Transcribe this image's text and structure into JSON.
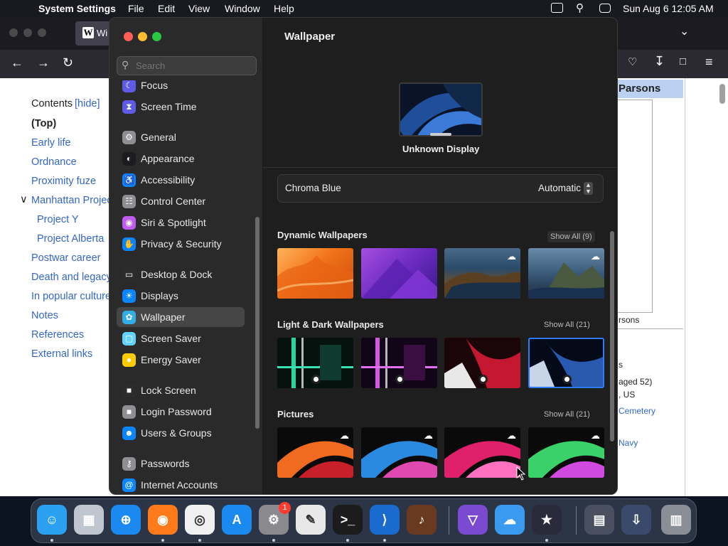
{
  "menubar": {
    "app": "System Settings",
    "menus": [
      "File",
      "Edit",
      "View",
      "Window",
      "Help"
    ],
    "datetime": "Sun Aug 6  12:05 AM"
  },
  "browser": {
    "tab_title": "Wi",
    "toc": {
      "heading": "Contents",
      "hide": "[hide]",
      "items": [
        "(Top)",
        "Early life",
        "Ordnance",
        "Proximity fuze",
        "Manhattan Project",
        "Project Y",
        "Project Alberta",
        "Postwar career",
        "Death and legacy",
        "In popular culture",
        "Notes",
        "References",
        "External links"
      ]
    },
    "article": {
      "infobox_title": "Parsons",
      "caption": "rsons",
      "line1": "s",
      "line2": "aged 52)",
      "line3": ", US",
      "link1": "Cemetery",
      "link2": "Navy"
    }
  },
  "settings": {
    "search_placeholder": "Search",
    "sidebar": [
      {
        "label": "Focus",
        "color": "#5e5ce6",
        "icon": "moon-icon"
      },
      {
        "label": "Screen Time",
        "color": "#5e5ce6",
        "icon": "hourglass-icon"
      },
      {
        "label": "General",
        "color": "#8e8e93",
        "icon": "gear-icon"
      },
      {
        "label": "Appearance",
        "color": "#1c1c1e",
        "icon": "appearance-icon"
      },
      {
        "label": "Accessibility",
        "color": "#0a84ff",
        "icon": "accessibility-icon"
      },
      {
        "label": "Control Center",
        "color": "#8e8e93",
        "icon": "toggles-icon"
      },
      {
        "label": "Siri & Spotlight",
        "color": "#bf5af2",
        "icon": "siri-icon"
      },
      {
        "label": "Privacy & Security",
        "color": "#0a84ff",
        "icon": "hand-icon"
      },
      {
        "label": "Desktop & Dock",
        "color": "#2c2c2e",
        "icon": "dock-icon"
      },
      {
        "label": "Displays",
        "color": "#0a84ff",
        "icon": "sun-icon"
      },
      {
        "label": "Wallpaper",
        "color": "#32ade6",
        "icon": "flower-icon"
      },
      {
        "label": "Screen Saver",
        "color": "#64d2ff",
        "icon": "screensaver-icon"
      },
      {
        "label": "Energy Saver",
        "color": "#ffcc00",
        "icon": "bulb-icon"
      },
      {
        "label": "Lock Screen",
        "color": "#2c2c2e",
        "icon": "lock-icon"
      },
      {
        "label": "Login Password",
        "color": "#8e8e93",
        "icon": "lock-icon"
      },
      {
        "label": "Users & Groups",
        "color": "#0a84ff",
        "icon": "users-icon"
      },
      {
        "label": "Passwords",
        "color": "#8e8e93",
        "icon": "key-icon"
      },
      {
        "label": "Internet Accounts",
        "color": "#0a84ff",
        "icon": "at-icon"
      }
    ],
    "selected": "Wallpaper",
    "title": "Wallpaper",
    "display_name": "Unknown Display",
    "current_wallpaper": "Chroma Blue",
    "mode": "Automatic",
    "sections": [
      {
        "title": "Dynamic Wallpapers",
        "show_all": "Show All (9)"
      },
      {
        "title": "Light & Dark Wallpapers",
        "show_all": "Show All (21)"
      },
      {
        "title": "Pictures",
        "show_all": "Show All (21)"
      }
    ]
  },
  "dock": {
    "apps": [
      "Finder",
      "Launchpad",
      "Safari",
      "Firefox",
      "Chrome",
      "App Store",
      "System Settings",
      "Script Editor",
      "Terminal",
      "VS Code",
      "Instruments",
      "Visual Studio",
      "iCloud",
      "Reeder",
      "Mission Control",
      "Downloads",
      "Trash"
    ],
    "badge": "1"
  }
}
